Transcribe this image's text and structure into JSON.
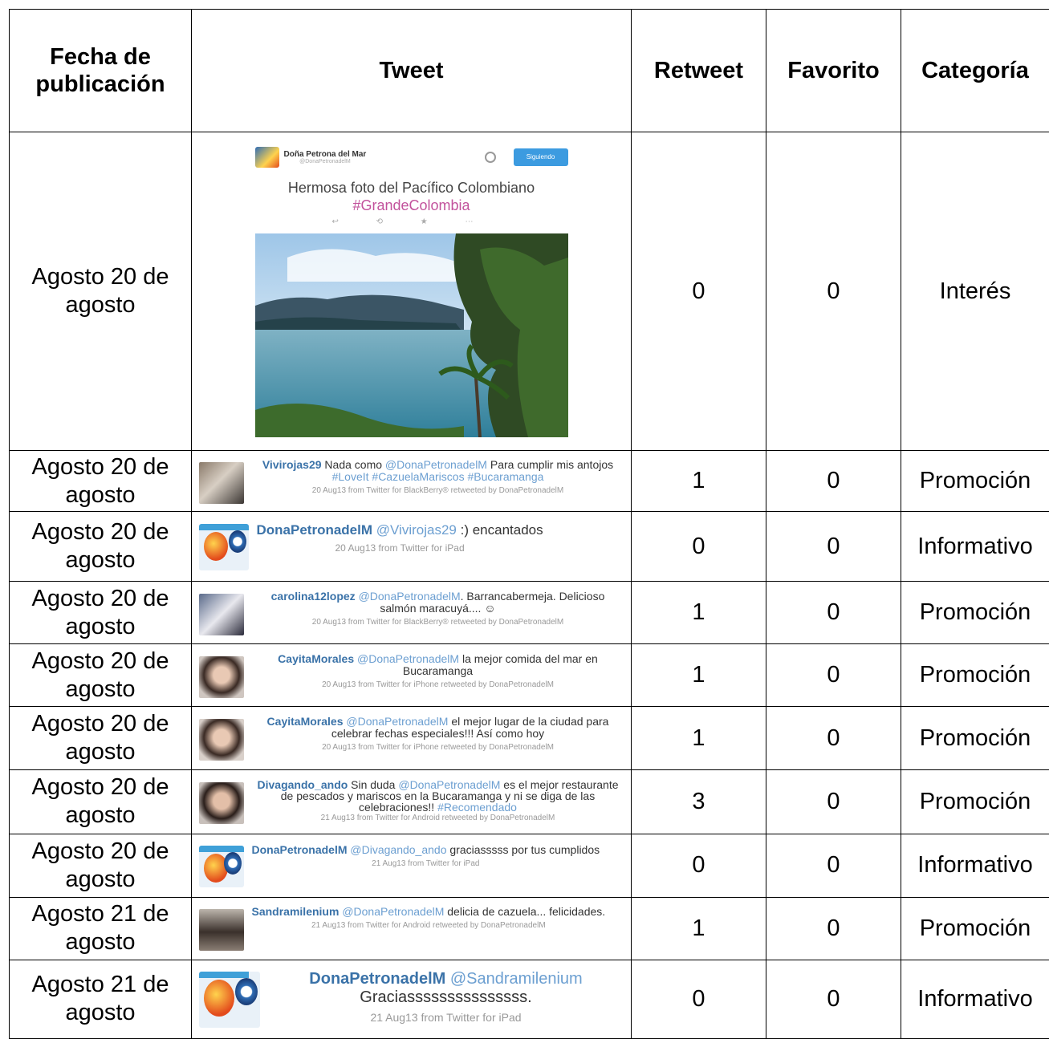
{
  "headers": {
    "date": "Fecha de publicación",
    "tweet": "Tweet",
    "retweet": "Retweet",
    "favorito": "Favorito",
    "categoria": "Categoría"
  },
  "featured": {
    "name": "Doña Petrona del Mar",
    "handle": "@DonaPetronadelM",
    "follow": "Siguiendo",
    "text": "Hermosa foto del Pacífico Colombiano",
    "hashtag": "#GrandeColombia"
  },
  "rows": [
    {
      "date": "Agosto 20 de agosto",
      "retweet": "0",
      "favorito": "0",
      "categoria": "Interés"
    },
    {
      "date": "Agosto 20 de agosto",
      "retweet": "1",
      "favorito": "0",
      "categoria": "Promoción",
      "user": "Vivirojas29",
      "pre": " Nada como ",
      "link": "@DonaPetronadelM",
      "post": " Para cumplir mis antojos ",
      "tags": "#LoveIt #CazuelaMariscos #Bucaramanga",
      "meta": "20 Aug13 from Twitter for BlackBerry® retweeted by DonaPetronadelM"
    },
    {
      "date": "Agosto 20 de agosto",
      "retweet": "0",
      "favorito": "0",
      "categoria": "Informativo",
      "user": "DonaPetronadelM",
      "pre": " ",
      "link": "@Vivirojas29",
      "post": " :) encantados",
      "tags": "",
      "meta": "20 Aug13 from Twitter for iPad"
    },
    {
      "date": "Agosto 20 de agosto",
      "retweet": "1",
      "favorito": "0",
      "categoria": "Promoción",
      "user": "carolina12lopez",
      "pre": " ",
      "link": "@DonaPetronadelM",
      "post": ". Barrancabermeja. Delicioso salmón maracuyá.... ☺",
      "tags": "",
      "meta": "20 Aug13 from Twitter for BlackBerry® retweeted by DonaPetronadelM"
    },
    {
      "date": "Agosto 20 de agosto",
      "retweet": "1",
      "favorito": "0",
      "categoria": "Promoción",
      "user": "CayitaMorales",
      "pre": " ",
      "link": "@DonaPetronadelM",
      "post": " la mejor comida del mar en Bucaramanga",
      "tags": "",
      "meta": "20 Aug13 from Twitter for iPhone retweeted by DonaPetronadelM"
    },
    {
      "date": "Agosto 20 de agosto",
      "retweet": "1",
      "favorito": "0",
      "categoria": "Promoción",
      "user": "CayitaMorales",
      "pre": " ",
      "link": "@DonaPetronadelM",
      "post": " el mejor lugar de la ciudad para celebrar fechas especiales!!! Así como hoy",
      "tags": "",
      "meta": "20 Aug13 from Twitter for iPhone retweeted by DonaPetronadelM"
    },
    {
      "date": "Agosto 20 de agosto",
      "retweet": "3",
      "favorito": "0",
      "categoria": "Promoción",
      "user": "Divagando_ando",
      "pre": " Sin duda ",
      "link": "@DonaPetronadelM",
      "post": " es el mejor restaurante de pescados y mariscos en la Bucaramanga y ni se diga de las celebraciones!! ",
      "tags": "#Recomendado",
      "meta": "21 Aug13 from Twitter for Android retweeted by DonaPetronadelM"
    },
    {
      "date": "Agosto 20 de agosto",
      "retweet": "0",
      "favorito": "0",
      "categoria": "Informativo",
      "user": "DonaPetronadelM",
      "pre": " ",
      "link": "@Divagando_ando",
      "post": " graciasssss por tus cumplidos",
      "tags": "",
      "meta": "21 Aug13 from Twitter for iPad"
    },
    {
      "date": "Agosto 21 de agosto",
      "retweet": "1",
      "favorito": "0",
      "categoria": "Promoción",
      "user": "Sandramilenium",
      "pre": " ",
      "link": "@DonaPetronadelM",
      "post": " delicia de cazuela... felicidades.",
      "tags": "",
      "meta": "21 Aug13 from Twitter for Android retweeted by DonaPetronadelM"
    },
    {
      "date": "Agosto 21 de agosto",
      "retweet": "0",
      "favorito": "0",
      "categoria": "Informativo",
      "user": "DonaPetronadelM",
      "pre": " ",
      "link": "@Sandramilenium",
      "post": " Graciasssssssssssssss.",
      "tags": "",
      "meta": "21 Aug13 from Twitter for iPad"
    }
  ]
}
